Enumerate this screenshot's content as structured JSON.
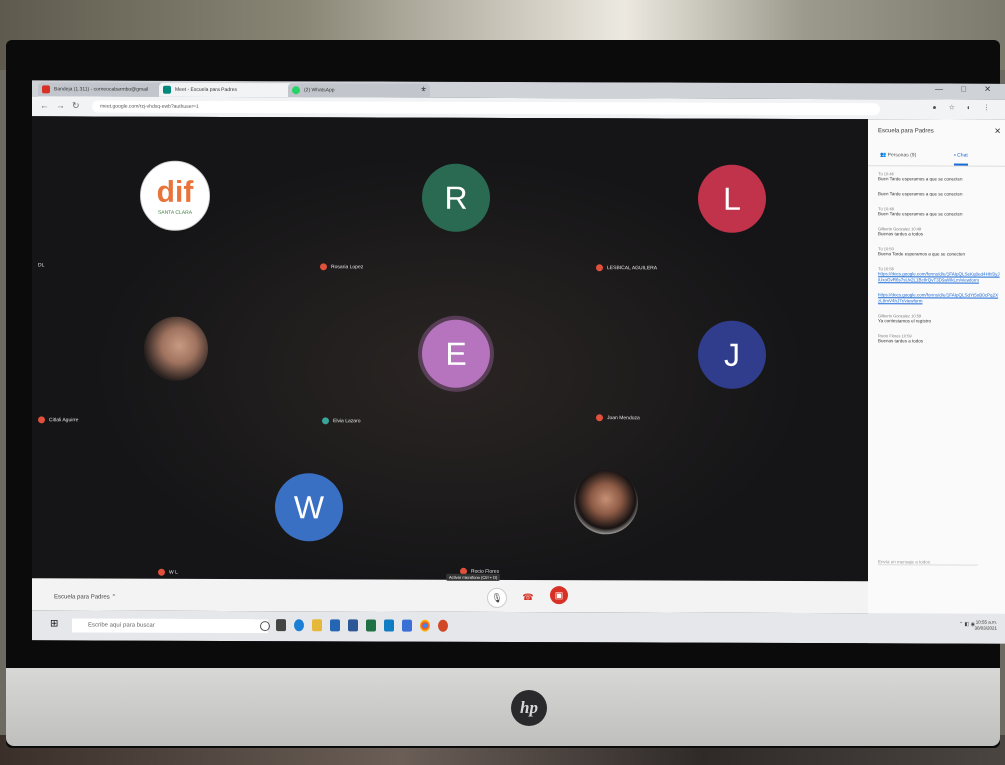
{
  "browser": {
    "tabs": [
      {
        "label": "Bandeja (1.311) - corneocabarmbo@gmail",
        "icon_color": "#d93025"
      },
      {
        "label": "Meet - Escuela para Padres",
        "icon_color": "#00897b"
      },
      {
        "label": "(2) WhatsApp",
        "icon_color": "#25d366"
      }
    ],
    "url": "meet.google.com/rzj-vhdxq-ewb?authuser=1",
    "new_tab": "+",
    "window_controls": "— □ ✕"
  },
  "meeting": {
    "name": "Escuela para Padres",
    "participants": [
      {
        "kind": "logo",
        "letter": "",
        "label": "DL",
        "logo_text": "dif",
        "logo_sub": "SANTA CLARA"
      },
      {
        "kind": "avatar",
        "letter": "R",
        "label": "Rosaria Lopez",
        "color": "#2b6a52"
      },
      {
        "kind": "avatar",
        "letter": "L",
        "label": "LESBICAL AGUILERA",
        "color": "#c0334b"
      },
      {
        "kind": "photo",
        "letter": "",
        "label": "Citlali Aguirre"
      },
      {
        "kind": "avatar",
        "letter": "E",
        "label": "Elvia Lazaro",
        "color": "#b574bd"
      },
      {
        "kind": "avatar",
        "letter": "J",
        "label": "Joan Mendoza",
        "color": "#2f3d8c"
      },
      {
        "kind": "avatar",
        "letter": "W",
        "label": "W L",
        "color": "#3a70c4"
      },
      {
        "kind": "photo",
        "letter": "",
        "label": "Rocio Flores"
      }
    ],
    "tooltip": "Activar micrófono (Ctrl + D)",
    "present_label": "Presentar ahora"
  },
  "panel": {
    "title": "Escuela para Padres",
    "tab_people": "Personas (9)",
    "tab_chat": "Chat",
    "messages": [
      {
        "who": "Tú  10:46",
        "text": "Buen Tarde esperamos a que se conecten"
      },
      {
        "who": "",
        "text": "Buen Tarde esperamos a que se conecten"
      },
      {
        "who": "Tú  10:48",
        "text": "Buen Tarde esperamos a que se conecten"
      },
      {
        "who": "Gilberto Gonzalez  10:49",
        "text": "Buenas tardes a todos"
      },
      {
        "who": "Tú  10:50",
        "text": "Buena Tarde esperamos a que se conecten"
      },
      {
        "who": "Tú  10:56",
        "link": "https://docs.google.com/forms/d/e/1FAIpQLSeKq8ed4Hhf3yJiUxoGvR6s7sUv2L1Bc8rQvT3D9aWkLm/viewform"
      },
      {
        "who": "",
        "link": "https://docs.google.com/forms/d/e/1FAIpQLSdYt5nB0cPq2XzL8mV4hJ7r/viewform"
      },
      {
        "who": "Gilberto Gonzalez  10:59",
        "text": "Ya contestamos el registro"
      },
      {
        "who": "Rocio Flores  10:59",
        "text": "Buenas tardes a todos"
      }
    ],
    "input_placeholder": "Envía un mensaje a todos"
  },
  "taskbar": {
    "search_placeholder": "Escribe aquí para buscar",
    "clock_time": "10:55 a.m.",
    "clock_date": "30/03/2021",
    "icons": [
      "task-view",
      "edge",
      "file-explorer",
      "store",
      "word",
      "excel",
      "teams",
      "chrome",
      "powerpoint"
    ]
  },
  "brand": "hp"
}
